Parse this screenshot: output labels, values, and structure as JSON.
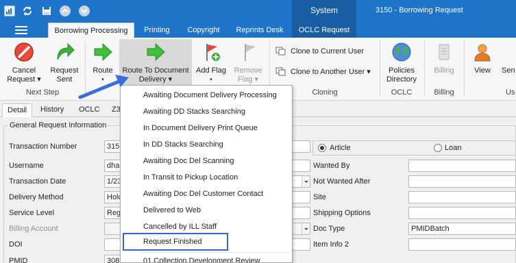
{
  "window": {
    "title": "3150 - Borrowing Request",
    "context_tab": "System"
  },
  "ribbon_tabs": [
    "Borrowing Processing",
    "Printing",
    "Copyright",
    "Reprints Desk",
    "OCLC Request"
  ],
  "ribbon": {
    "cancel": {
      "line1": "Cancel",
      "line2": "Request ▾"
    },
    "request_sent": {
      "line1": "Request",
      "line2": "Sent"
    },
    "route": {
      "line1": "Route",
      "line2": "▾"
    },
    "route_to_dd": {
      "line1": "Route To Document",
      "line2": "Delivery ▾"
    },
    "add_flag": {
      "line1": "Add Flag",
      "line2": "▾"
    },
    "remove_flag": {
      "line1": "Remove",
      "line2": "Flag ▾"
    },
    "clone_current": "Clone to Current User",
    "clone_another": "Clone to Another User ▾",
    "policies": {
      "line1": "Policies",
      "line2": "Directory"
    },
    "billing": "Billing",
    "view": "View",
    "send": "Sen",
    "groups": {
      "next_step": "Next Step",
      "cloning": "Cloning",
      "oclc": "OCLC",
      "billing": "Billing",
      "usc": "Us"
    }
  },
  "lower_tabs": [
    "Detail",
    "History",
    "OCLC",
    "Z3"
  ],
  "form": {
    "group_title": "General Request Information",
    "labels": {
      "transaction_number": "Transaction Number",
      "username": "Username",
      "transaction_date": "Transaction Date",
      "delivery_method": "Delivery Method",
      "service_level": "Service Level",
      "billing_account": "Billing Account",
      "doi": "DOI",
      "pmid": "PMID",
      "wanted_by": "Wanted By",
      "not_wanted_after": "Not Wanted After",
      "site": "Site",
      "shipping_options": "Shipping Options",
      "doc_type": "Doc Type",
      "item_info_2": "Item Info 2"
    },
    "values": {
      "transaction_number": "315",
      "username": "dha",
      "transaction_date": "1/23",
      "delivery_method": "Holc",
      "service_level": "Reg",
      "pmid": "308",
      "doc_type": "PMIDBatch"
    },
    "radio_article": "Article",
    "radio_loan": "Loan"
  },
  "menu": {
    "items": [
      "Awaiting Document Delivery Processing",
      "Awaiting DD Stacks Searching",
      "In Document Delivery Print Queue",
      "In DD Stacks Searching",
      "Awaiting Doc Del Scanning",
      "In Transit to Pickup Location",
      "Awaiting Doc Del Customer Contact",
      "Delivered to Web",
      "Cancelled by ILL Staff",
      "Request Finished",
      "01 Collection Development Review"
    ]
  },
  "colors": {
    "titlebar": "#1d74c8",
    "context_tab": "#195ea4",
    "highlight_box": "#3366cc",
    "arrow": "#3a6fd8"
  }
}
